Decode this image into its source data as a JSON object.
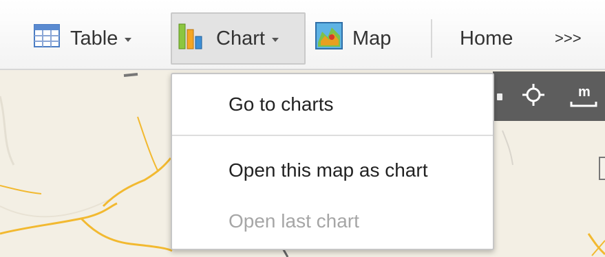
{
  "toolbar": {
    "table_label": "Table",
    "chart_label": "Chart",
    "map_label": "Map",
    "home_label": "Home",
    "more_label": ">>>"
  },
  "chart_menu": {
    "go_to_charts": "Go to charts",
    "open_this_map_as_chart": "Open this map as chart",
    "open_last_chart": "Open last chart",
    "open_last_chart_disabled": true
  },
  "map_controls": {
    "ruler_label": "m"
  },
  "icons": {
    "table": "table-grid-icon",
    "chart": "bar-chart-icon",
    "map": "map-thumbnail-icon",
    "locate": "crosshair-icon",
    "ruler": "ruler-icon"
  },
  "colors": {
    "toolbar_bg": "#f3f3f3",
    "active_button_bg": "#e3e3e3",
    "menu_text": "#222222",
    "disabled_text": "#a6a6a6",
    "map_controls_bg": "#5d5d5d",
    "map_land": "#f3efe4",
    "map_roads": "#f2b930"
  }
}
